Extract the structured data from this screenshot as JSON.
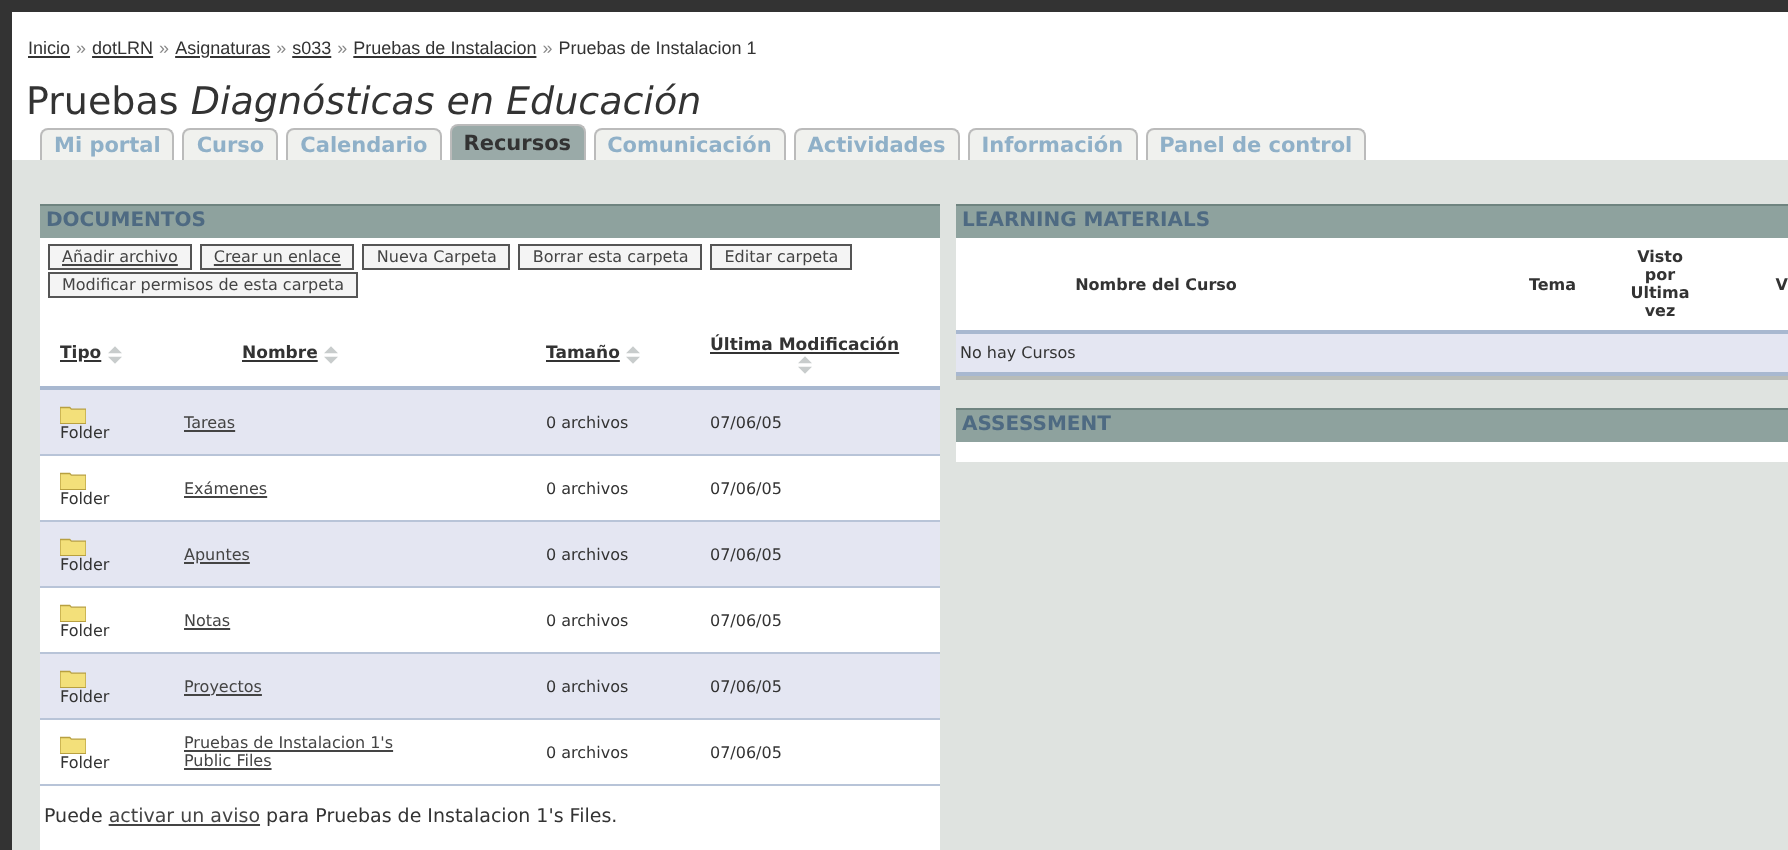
{
  "breadcrumb": [
    {
      "label": "Inicio",
      "link": true
    },
    {
      "label": "dotLRN",
      "link": true
    },
    {
      "label": "Asignaturas",
      "link": true
    },
    {
      "label": "s033",
      "link": true
    },
    {
      "label": "Pruebas de Instalacion",
      "link": true
    },
    {
      "label": "Pruebas de Instalacion 1",
      "link": false
    }
  ],
  "breadcrumb_separator": "»",
  "title": {
    "plain": "Pruebas",
    "italic": "Diagnósticas en Educación"
  },
  "tabs": [
    {
      "label": "Mi portal",
      "selected": false
    },
    {
      "label": "Curso",
      "selected": false
    },
    {
      "label": "Calendario",
      "selected": false
    },
    {
      "label": "Recursos",
      "selected": true
    },
    {
      "label": "Comunicación",
      "selected": false
    },
    {
      "label": "Actividades",
      "selected": false
    },
    {
      "label": "Información",
      "selected": false
    },
    {
      "label": "Panel de control",
      "selected": false
    }
  ],
  "documents": {
    "title": "DOCUMENTOS",
    "buttons": [
      {
        "label": "Añadir archivo",
        "kind": "link"
      },
      {
        "label": "Crear un enlace",
        "kind": "link"
      },
      {
        "label": "Nueva Carpeta",
        "kind": "plain"
      },
      {
        "label": "Borrar esta carpeta",
        "kind": "plain"
      },
      {
        "label": "Editar carpeta",
        "kind": "plain"
      },
      {
        "label": "Modificar permisos de esta carpeta",
        "kind": "plain"
      }
    ],
    "columns": [
      "Tipo",
      "Nombre",
      "Tamaño",
      "Última Modificación"
    ],
    "rows": [
      {
        "type": "Folder",
        "name": "Tareas",
        "size": "0 archivos",
        "modified": "07/06/05"
      },
      {
        "type": "Folder",
        "name": "Exámenes",
        "size": "0 archivos",
        "modified": "07/06/05"
      },
      {
        "type": "Folder",
        "name": "Apuntes",
        "size": "0 archivos",
        "modified": "07/06/05"
      },
      {
        "type": "Folder",
        "name": "Notas",
        "size": "0 archivos",
        "modified": "07/06/05"
      },
      {
        "type": "Folder",
        "name": "Proyectos",
        "size": "0 archivos",
        "modified": "07/06/05"
      },
      {
        "type": "Folder",
        "name": "Pruebas de Instalacion 1's Public Files",
        "size": "0 archivos",
        "modified": "07/06/05"
      }
    ],
    "notice": {
      "before": "Puede",
      "link": "activar un aviso",
      "after": "para Pruebas de Instalacion 1's Files."
    }
  },
  "learning_materials": {
    "title": "LEARNING MATERIALS",
    "columns": [
      "Nombre del Curso",
      "Tema",
      "Visto por Ultima vez",
      "V"
    ],
    "empty": "No hay Cursos"
  },
  "assessment": {
    "title": "ASSESSMENT"
  }
}
